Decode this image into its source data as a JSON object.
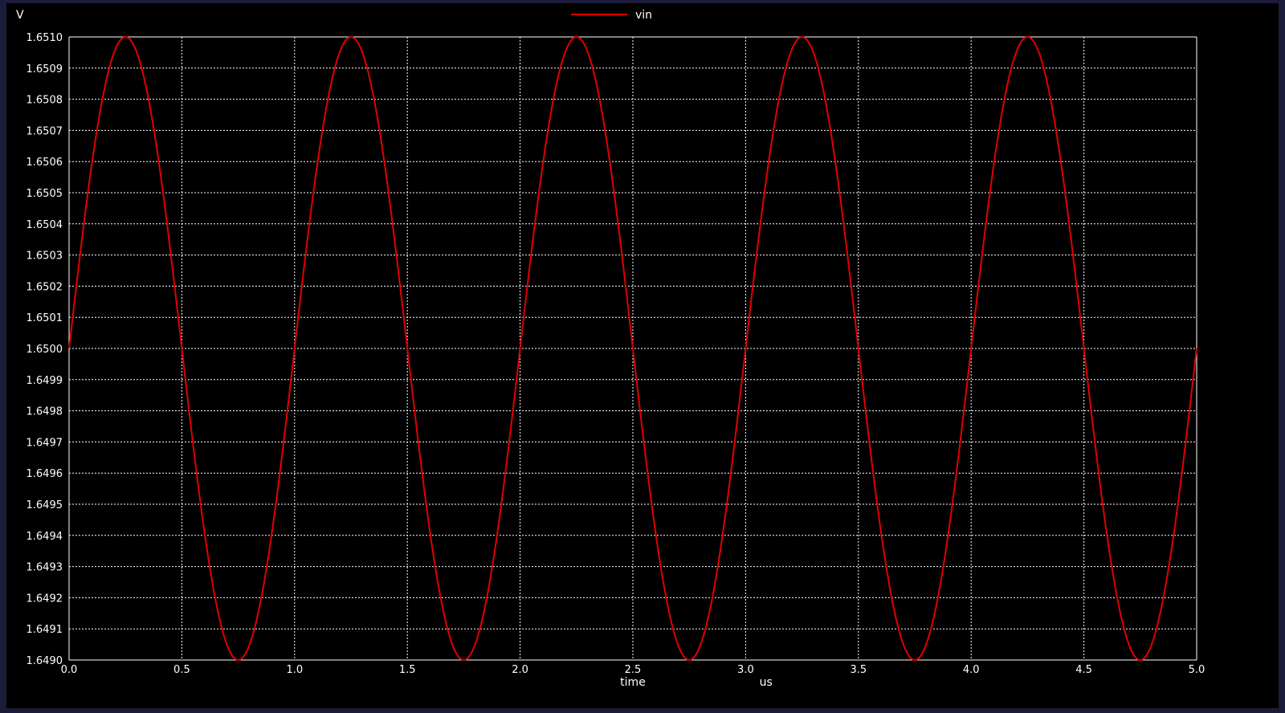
{
  "chart_data": {
    "type": "line",
    "ylabel": "V",
    "xlabel": "time",
    "xunit": "us",
    "xlim": [
      0.0,
      5.0
    ],
    "ylim": [
      1.649,
      1.651
    ],
    "grid": true,
    "legend_position": "top-center",
    "x_ticks": [
      "0.0",
      "0.5",
      "1.0",
      "1.5",
      "2.0",
      "2.5",
      "3.0",
      "3.5",
      "4.0",
      "4.5",
      "5.0"
    ],
    "y_ticks": [
      "1.6510",
      "1.6509",
      "1.6508",
      "1.6507",
      "1.6506",
      "1.6505",
      "1.6504",
      "1.6503",
      "1.6502",
      "1.6501",
      "1.6500",
      "1.6499",
      "1.6498",
      "1.6497",
      "1.6496",
      "1.6495",
      "1.6494",
      "1.6493",
      "1.6492",
      "1.6491",
      "1.6490"
    ],
    "series": [
      {
        "name": "vin",
        "color": "#e00000",
        "x": [
          0.0,
          0.25,
          0.5,
          0.75,
          1.0,
          1.25,
          1.5,
          1.75,
          2.0,
          2.25,
          2.5,
          2.75,
          3.0,
          3.25,
          3.5,
          3.75,
          4.0,
          4.25,
          4.5,
          4.75,
          5.0
        ],
        "y": [
          1.65,
          1.651,
          1.65,
          1.649,
          1.65,
          1.651,
          1.65,
          1.649,
          1.65,
          1.651,
          1.65,
          1.649,
          1.65,
          1.651,
          1.65,
          1.649,
          1.65,
          1.651,
          1.65,
          1.649,
          1.65
        ]
      }
    ]
  },
  "colors": {
    "background": "#000000",
    "frame": "#1b1b3a",
    "grid": "#ffffff",
    "text": "#ffffff"
  }
}
